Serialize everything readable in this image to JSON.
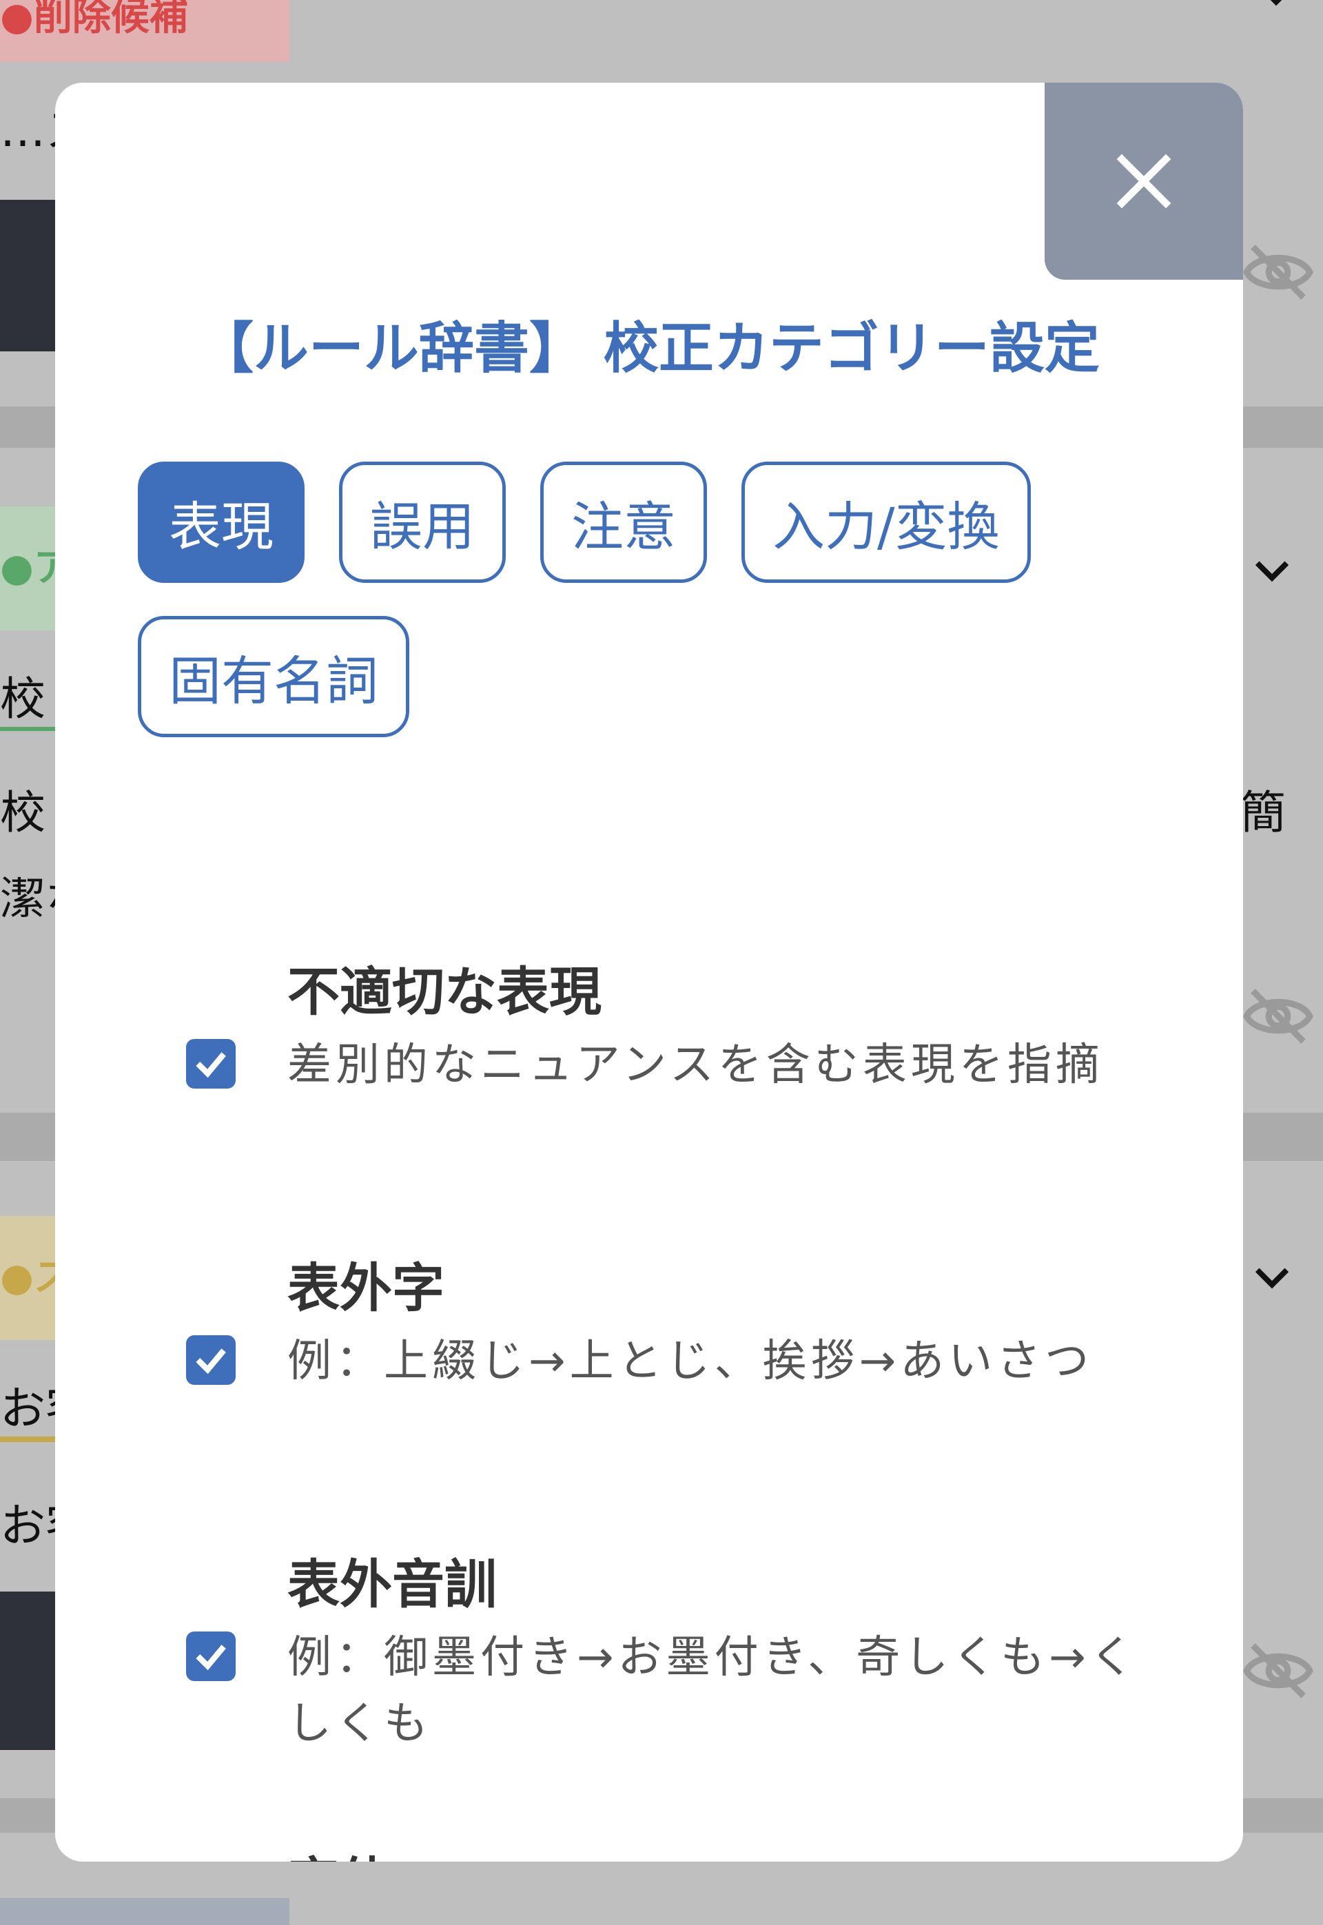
{
  "background": {
    "tag_delete": "●削除候補",
    "tag_green": "●ア",
    "tag_yellow": "●ス",
    "line1": "…ス",
    "line2": "校",
    "line3": "校",
    "line4": "潔な",
    "line5": "お客",
    "line6": "お客",
    "right_char": "簡",
    "colors": {
      "delete": "#d84848",
      "green": "#59a86a",
      "yellow": "#c6a84a"
    }
  },
  "modal": {
    "title": "【ルール辞書】 校正カテゴリー設定",
    "close_icon": "close-icon",
    "tabs": [
      {
        "label": "表現",
        "active": true
      },
      {
        "label": "誤用",
        "active": false
      },
      {
        "label": "注意",
        "active": false
      },
      {
        "label": "入力/変換",
        "active": false
      },
      {
        "label": "固有名詞",
        "active": false
      }
    ],
    "rules": [
      {
        "name": "不適切な表現",
        "desc": "差別的なニュアンスを含む表現を指摘",
        "checked": true
      },
      {
        "name": "表外字",
        "desc": "例：上綴じ→上とじ、挨拶→あいさつ",
        "checked": true
      },
      {
        "name": "表外音訓",
        "desc": "例：御墨付き→お墨付き、奇しくも→くしくも",
        "checked": true
      },
      {
        "name": "字体",
        "desc": "",
        "checked": true
      }
    ],
    "accent_color": "#3f6fba"
  }
}
